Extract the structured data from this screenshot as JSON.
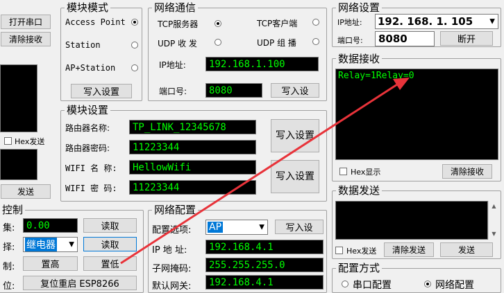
{
  "left_panel": {
    "open_port": "打开串口",
    "clear_recv": "清除接收",
    "hex_send": "Hex发送",
    "send": "发送"
  },
  "module_mode": {
    "title": "模块模式",
    "access_point": "Access Point",
    "station": "Station",
    "ap_station": "AP+Station",
    "write": "写入设置"
  },
  "network_comm": {
    "title": "网络通信",
    "tcp_server": "TCP服务器",
    "tcp_client": "TCP客户端",
    "udp_send": "UDP 收 发",
    "udp_group": "UDP 组 播",
    "ip_label": "IP地址:",
    "ip_value": "192.168.1.100",
    "port_label": "端口号:",
    "port_value": "8080",
    "write": "写入设"
  },
  "network_settings": {
    "title": "网络设置",
    "ip_label": "IP地址:",
    "ip_value": "192. 168. 1. 105",
    "port_label": "端口号:",
    "port_value": "8080",
    "disconnect": "断开"
  },
  "data_recv": {
    "title": "数据接收",
    "content": "Relay=1Relay=0",
    "hex_display": "Hex显示",
    "clear": "清除接收"
  },
  "module_settings": {
    "title": "模块设置",
    "router_name_label": "路由器名称:",
    "router_name_value": "TP_LINK_12345678",
    "router_pwd_label": "路由器密码:",
    "router_pwd_value": "11223344",
    "wifi_name_label": "WIFI 名 称:",
    "wifi_name_value": "HellowWifi",
    "wifi_pwd_label": "WIFI 密 码:",
    "wifi_pwd_value": "11223344",
    "write1": "写入设置",
    "write2": "写入设置"
  },
  "data_send": {
    "title": "数据发送",
    "hex_send": "Hex发送",
    "clear": "清除发送",
    "send": "发送"
  },
  "control": {
    "title": "控制",
    "collect_label": "集:",
    "collect_value": "0.00",
    "read1": "读取",
    "select_label": "择:",
    "select_value": "继电器",
    "read2": "读取",
    "ctrl_label": "制:",
    "set_high": "置高",
    "set_low": "置低",
    "reset_label": "位:",
    "reset_btn": "复位重启 ESP8266"
  },
  "network_config": {
    "title": "网络配置",
    "option_label": "配置选项:",
    "option_value": "AP",
    "write": "写入设",
    "ip_label": "IP 地 址:",
    "ip_value": "192.168.4.1",
    "mask_label": "子网掩码:",
    "mask_value": "255.255.255.0",
    "gw_label": "默认网关:",
    "gw_value": "192.168.4.1"
  },
  "config_mode": {
    "title": "配置方式",
    "serial": "串口配置",
    "network": "网络配置"
  },
  "colors": {
    "lcd_text": "#00ff00",
    "arrow": "#e8333a"
  }
}
